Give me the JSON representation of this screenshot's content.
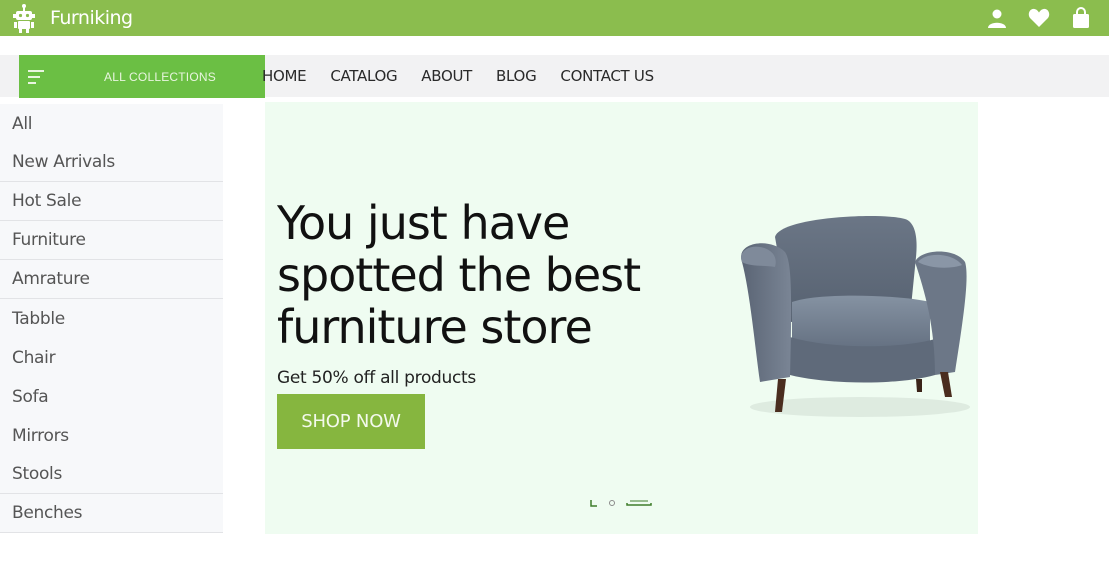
{
  "brand": {
    "name": "Furniking",
    "logo_icon": "robot-logo-icon"
  },
  "header_icons": [
    {
      "name": "user-icon"
    },
    {
      "name": "heart-icon"
    },
    {
      "name": "shopping-bag-icon"
    }
  ],
  "collections": {
    "label": "ALL COLLECTIONS",
    "icon": "menu-lines-icon"
  },
  "nav": {
    "home": "HOME",
    "catalog": "CATALOG",
    "about": "ABOUT",
    "blog": "BLOG",
    "contact": "CONTACT US"
  },
  "sidebar": {
    "items": [
      {
        "label": "All"
      },
      {
        "label": "New Arrivals"
      },
      {
        "label": "Hot Sale"
      },
      {
        "label": "Furniture"
      },
      {
        "label": "Amrature"
      },
      {
        "label": "Tabble"
      },
      {
        "label": "Chair"
      },
      {
        "label": "Sofa"
      },
      {
        "label": "Mirrors"
      },
      {
        "label": "Stools"
      },
      {
        "label": "Benches"
      }
    ]
  },
  "hero": {
    "headline": "You just have spotted the best furniture store",
    "subtitle": "Get 50% off all products",
    "cta": "SHOP NOW",
    "image": "armchair-image",
    "slides_total": 3,
    "active_slide": 3
  },
  "colors": {
    "topbar": "#8bbd4e",
    "collections": "#6bbf44",
    "button": "#86b63f",
    "hero_bg": "#effcf1"
  }
}
